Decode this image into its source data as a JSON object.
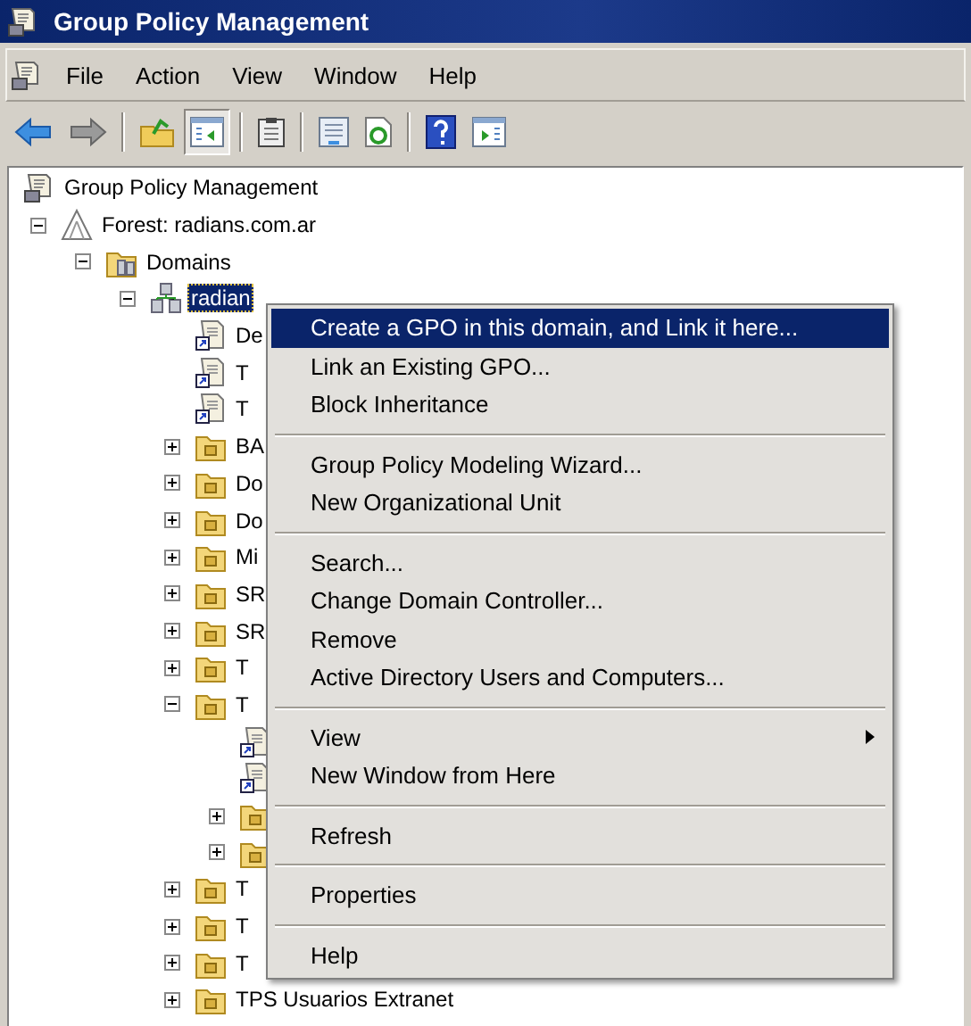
{
  "window": {
    "title": "Group Policy Management"
  },
  "menu_bar": [
    "File",
    "Action",
    "View",
    "Window",
    "Help"
  ],
  "toolbar": [
    {
      "kind": "back",
      "pressed": false
    },
    {
      "kind": "forward",
      "pressed": false
    },
    {
      "kind": "separator"
    },
    {
      "kind": "up",
      "pressed": false
    },
    {
      "kind": "tree-toggle",
      "pressed": true
    },
    {
      "kind": "separator"
    },
    {
      "kind": "clipboard",
      "pressed": false
    },
    {
      "kind": "separator"
    },
    {
      "kind": "properties",
      "pressed": false
    },
    {
      "kind": "refresh",
      "pressed": false
    },
    {
      "kind": "separator"
    },
    {
      "kind": "help",
      "pressed": false
    },
    {
      "kind": "action-pane",
      "pressed": false
    }
  ],
  "tree": [
    {
      "kind": "root",
      "label": "Group Policy Management",
      "selected": false,
      "children": [
        {
          "kind": "forest",
          "label": "Forest: radians.com.ar",
          "selected": false,
          "expanded": true,
          "children": [
            {
              "kind": "domains",
              "label": "Domains",
              "selected": false,
              "expanded": true,
              "children": [
                {
                  "kind": "domain",
                  "label": "radian",
                  "selected": true,
                  "expanded": true,
                  "children": [
                    {
                      "kind": "gpo-link",
                      "label": "De",
                      "selected": false
                    },
                    {
                      "kind": "gpo-link",
                      "label": "T",
                      "selected": false
                    },
                    {
                      "kind": "gpo-link",
                      "label": "T",
                      "selected": false
                    },
                    {
                      "kind": "ou",
                      "label": "BA",
                      "selected": false,
                      "expanded": false
                    },
                    {
                      "kind": "ou",
                      "label": "Do",
                      "selected": false,
                      "expanded": false
                    },
                    {
                      "kind": "ou",
                      "label": "Do",
                      "selected": false,
                      "expanded": false
                    },
                    {
                      "kind": "ou",
                      "label": "Mi",
                      "selected": false,
                      "expanded": false
                    },
                    {
                      "kind": "ou",
                      "label": "SR",
                      "selected": false,
                      "expanded": false
                    },
                    {
                      "kind": "ou",
                      "label": "SR",
                      "selected": false,
                      "expanded": false
                    },
                    {
                      "kind": "ou",
                      "label": "T",
                      "selected": false,
                      "expanded": false
                    },
                    {
                      "kind": "ou",
                      "label": "T",
                      "selected": false,
                      "expanded": true,
                      "children": [
                        {
                          "kind": "gpo-link"
                        },
                        {
                          "kind": "gpo-link"
                        },
                        {
                          "kind": "ou",
                          "expanded": false
                        },
                        {
                          "kind": "ou",
                          "expanded": false
                        }
                      ]
                    },
                    {
                      "kind": "ou",
                      "label": "T",
                      "selected": false,
                      "expanded": false
                    },
                    {
                      "kind": "ou",
                      "label": "T",
                      "selected": false,
                      "expanded": false
                    },
                    {
                      "kind": "ou",
                      "label": "T",
                      "selected": false,
                      "expanded": false
                    },
                    {
                      "kind": "ou",
                      "label": "TPS Usuarios Extranet",
                      "selected": false,
                      "expanded": false
                    }
                  ]
                }
              ]
            }
          ]
        }
      ]
    }
  ],
  "context_menu": {
    "items": [
      {
        "kind": "item",
        "label": "Create a GPO in this domain, and Link it here...",
        "selected": true,
        "submenu": false
      },
      {
        "kind": "item",
        "label": "Link an Existing GPO...",
        "selected": false,
        "submenu": false
      },
      {
        "kind": "item",
        "label": "Block Inheritance",
        "selected": false,
        "submenu": false
      },
      {
        "kind": "separator"
      },
      {
        "kind": "item",
        "label": "Group Policy Modeling Wizard...",
        "selected": false,
        "submenu": false
      },
      {
        "kind": "item",
        "label": "New Organizational Unit",
        "selected": false,
        "submenu": false
      },
      {
        "kind": "separator"
      },
      {
        "kind": "item",
        "label": "Search...",
        "selected": false,
        "submenu": false
      },
      {
        "kind": "item",
        "label": "Change Domain Controller...",
        "selected": false,
        "submenu": false
      },
      {
        "kind": "item",
        "label": "Remove",
        "selected": false,
        "submenu": false
      },
      {
        "kind": "item",
        "label": "Active Directory Users and Computers...",
        "selected": false,
        "submenu": false
      },
      {
        "kind": "separator"
      },
      {
        "kind": "item",
        "label": "View",
        "selected": false,
        "submenu": true
      },
      {
        "kind": "item",
        "label": "New Window from Here",
        "selected": false,
        "submenu": false
      },
      {
        "kind": "separator"
      },
      {
        "kind": "item",
        "label": "Refresh",
        "selected": false,
        "submenu": false
      },
      {
        "kind": "separator"
      },
      {
        "kind": "item",
        "label": "Properties",
        "selected": false,
        "submenu": false
      },
      {
        "kind": "separator"
      },
      {
        "kind": "item",
        "label": "Help",
        "selected": false,
        "submenu": false
      }
    ]
  }
}
